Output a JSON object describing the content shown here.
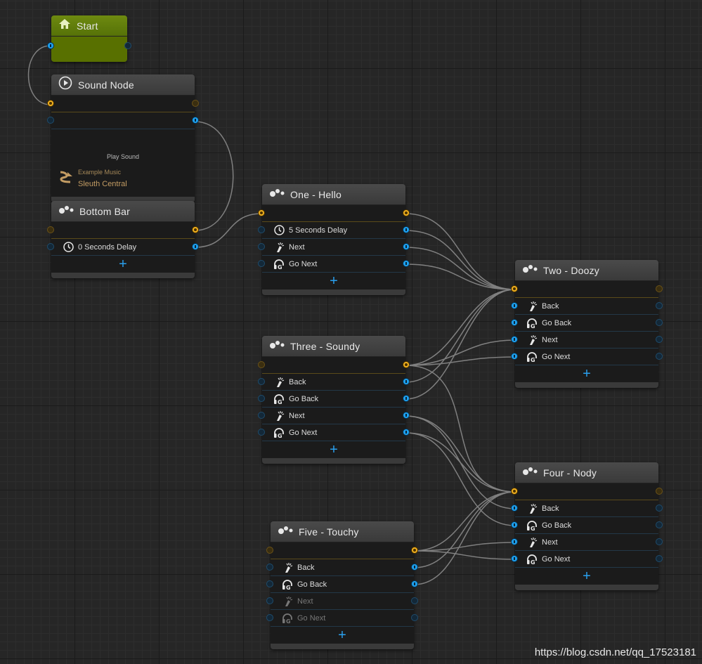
{
  "canvas": {
    "watermark": "https://blog.csdn.net/qq_17523181"
  },
  "nodes": {
    "start": {
      "title": "Start"
    },
    "sound": {
      "title": "Sound Node",
      "play_label": "Play Sound",
      "music_caption": "Example Music",
      "music_name": "Sleuth Central"
    },
    "bottom_bar": {
      "title": "Bottom Bar",
      "rows": [
        "0 Seconds Delay"
      ]
    },
    "one": {
      "title": "One - Hello",
      "rows": [
        "5 Seconds Delay",
        "Next",
        "Go Next"
      ]
    },
    "two": {
      "title": "Two - Doozy",
      "rows": [
        "Back",
        "Go Back",
        "Next",
        "Go Next"
      ]
    },
    "three": {
      "title": "Three - Soundy",
      "rows": [
        "Back",
        "Go Back",
        "Next",
        "Go Next"
      ]
    },
    "four": {
      "title": "Four - Nody",
      "rows": [
        "Back",
        "Go Back",
        "Next",
        "Go Next"
      ]
    },
    "five": {
      "title": "Five - Touchy",
      "rows": [
        "Back",
        "Go Back",
        "Next",
        "Go Next"
      ]
    }
  },
  "icons": {
    "home": "home-icon",
    "play": "play-circle-icon",
    "graph": "graph-nodes-icon",
    "clock": "clock-icon",
    "touch": "touch-tap-icon",
    "headset": "gamepad-headset-icon",
    "add": "plus-icon"
  },
  "colors": {
    "background": "#262626",
    "node_body": "#1b1b1b",
    "start_header": "#6e8a10",
    "socket_yellow": "#f0b020",
    "socket_blue": "#1ea0ee",
    "accent_plus": "#2aa0ee",
    "music_text": "#c39c63"
  }
}
